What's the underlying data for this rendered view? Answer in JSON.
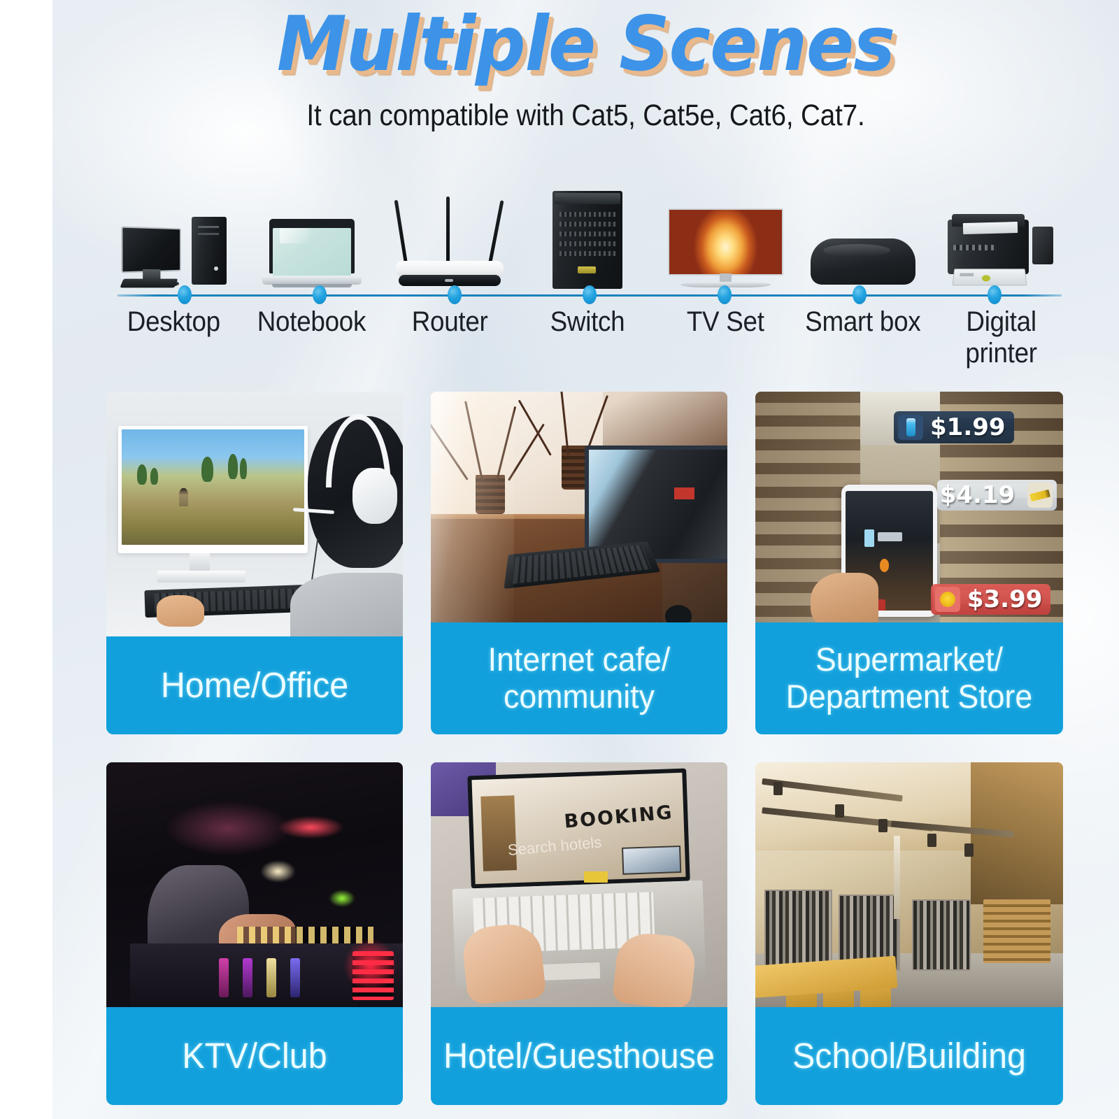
{
  "header": {
    "title": "Multiple Scenes",
    "subtitle": "It can compatible with Cat5, Cat5e, Cat6, Cat7.",
    "title_color": "#3d93e8",
    "title_shadow_color": "#e8b98c"
  },
  "accent_color": "#12a0dc",
  "timeline": {
    "line_color": "#1a82be",
    "dot_color": "#22a3e0",
    "devices": [
      {
        "label": "Desktop",
        "icon": "desktop-computer-icon"
      },
      {
        "label": "Notebook",
        "icon": "laptop-icon"
      },
      {
        "label": "Router",
        "icon": "wifi-router-icon"
      },
      {
        "label": "Switch",
        "icon": "network-switch-cabinet-icon"
      },
      {
        "label": "TV Set",
        "icon": "television-icon"
      },
      {
        "label": "Smart box",
        "icon": "smart-tv-box-icon"
      },
      {
        "label": "Digital printer",
        "icon": "printer-icon"
      }
    ]
  },
  "scenes": [
    {
      "label": "Home/Office",
      "scene": "gamer-at-desk-with-headset"
    },
    {
      "label": "Internet cafe/\ncommunity",
      "scene": "internet-cafe-desks-with-monitors"
    },
    {
      "label": "Supermarket/\nDepartment Store",
      "scene": "supermarket-aisle-ar-phone"
    },
    {
      "label": "KTV/Club",
      "scene": "dj-mixing-console-club-lights"
    },
    {
      "label": "Hotel/Guesthouse",
      "scene": "laptop-showing-hotel-booking-site"
    },
    {
      "label": "School/Building",
      "scene": "library-bookshelves-and-tables"
    }
  ],
  "supermarket_tags": [
    {
      "price": "$1.99",
      "icon": "water-bottle-icon"
    },
    {
      "price": "$4.19",
      "icon": "pencil-icon"
    },
    {
      "price": "$3.99",
      "icon": "banana-icon"
    }
  ],
  "hotel_screen": {
    "heading": "BOOKING",
    "subtext": "Search hotels"
  }
}
